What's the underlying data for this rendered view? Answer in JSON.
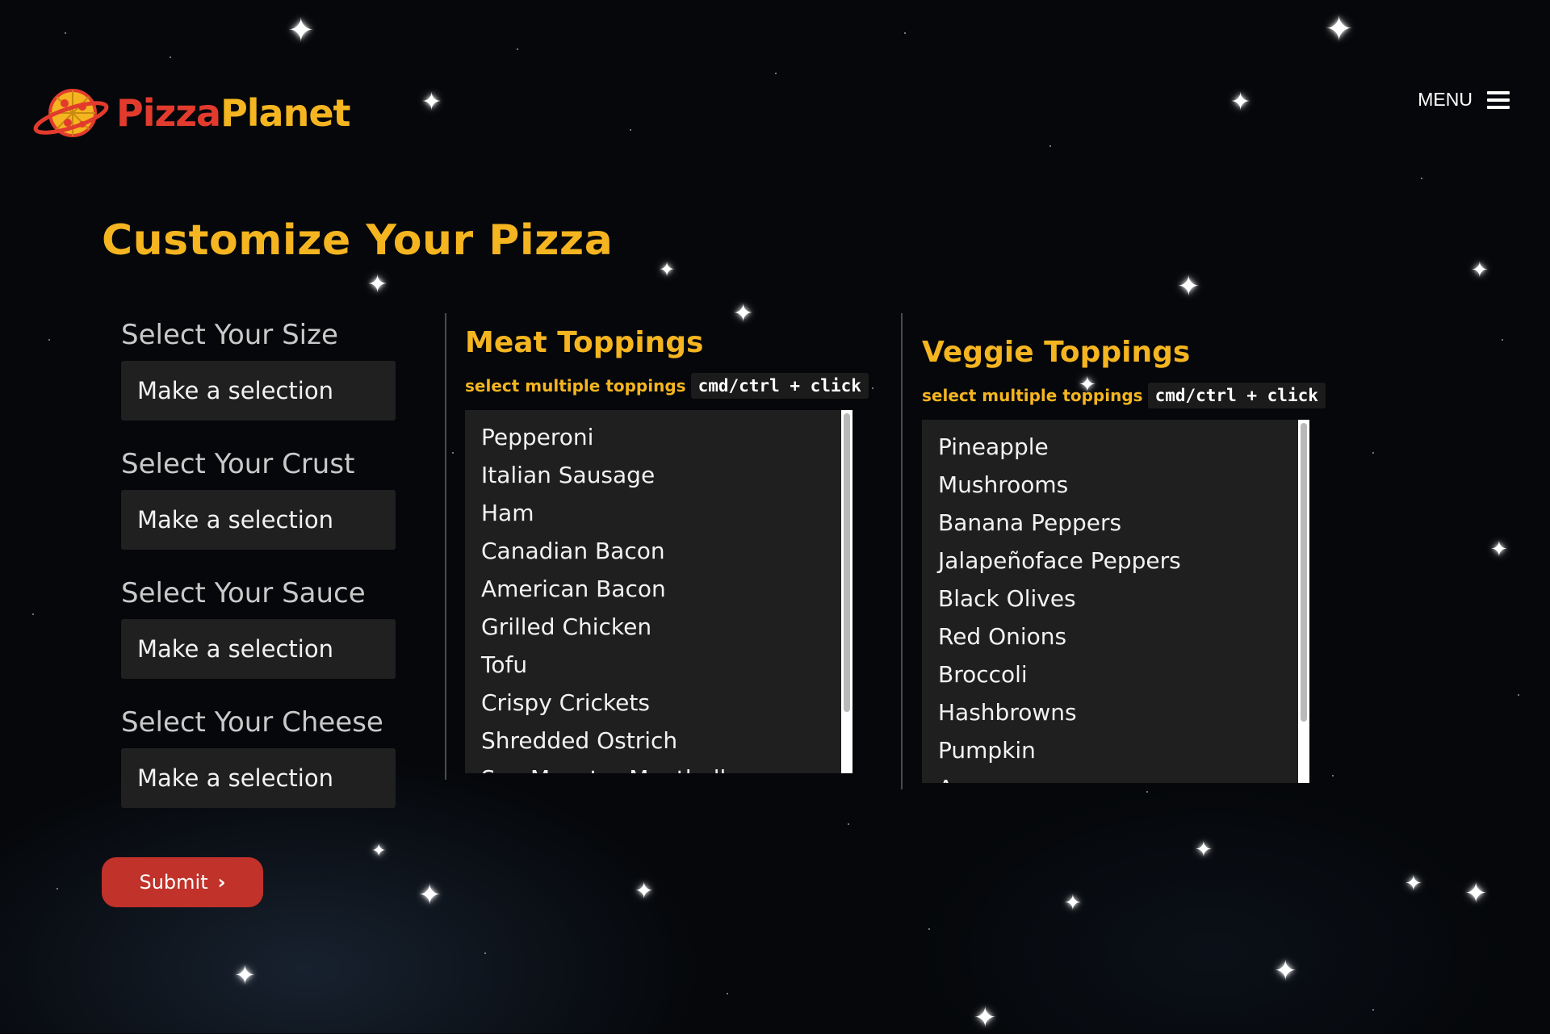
{
  "brand": {
    "word1": "Pizza",
    "word2": "Planet"
  },
  "nav": {
    "menu_label": "MENU"
  },
  "page": {
    "title": "Customize Your Pizza"
  },
  "form": {
    "fields": [
      {
        "label": "Select Your Size",
        "value": "Make a selection"
      },
      {
        "label": "Select Your Crust",
        "value": "Make a selection"
      },
      {
        "label": "Select Your Sauce",
        "value": "Make a selection"
      },
      {
        "label": "Select Your Cheese",
        "value": "Make a selection"
      }
    ],
    "submit_label": "Submit"
  },
  "meat": {
    "title": "Meat Toppings",
    "hint": "select multiple toppings",
    "shortcut": "cmd/ctrl + click",
    "items": [
      "Pepperoni",
      "Italian Sausage",
      "Ham",
      "Canadian Bacon",
      "American Bacon",
      "Grilled Chicken",
      "Tofu",
      "Crispy Crickets",
      "Shredded Ostrich",
      "Sea Monster Meatballs"
    ]
  },
  "veggie": {
    "title": "Veggie Toppings",
    "hint": "select multiple toppings",
    "shortcut": "cmd/ctrl + click",
    "items": [
      "Pineapple",
      "Mushrooms",
      "Banana Peppers",
      "Jalapeñoface Peppers",
      "Black Olives",
      "Red Onions",
      "Broccoli",
      "Hashbrowns",
      "Pumpkin",
      "Asparagus"
    ]
  },
  "colors": {
    "accent": "#f5b520",
    "brand_red": "#e23b2e",
    "button": "#c0322a",
    "background": "#05070a",
    "field_bg": "#202020"
  },
  "icons": {
    "menu": "hamburger-icon",
    "submit": "chevron-right-icon",
    "logo": "pizza-planet-icon"
  }
}
